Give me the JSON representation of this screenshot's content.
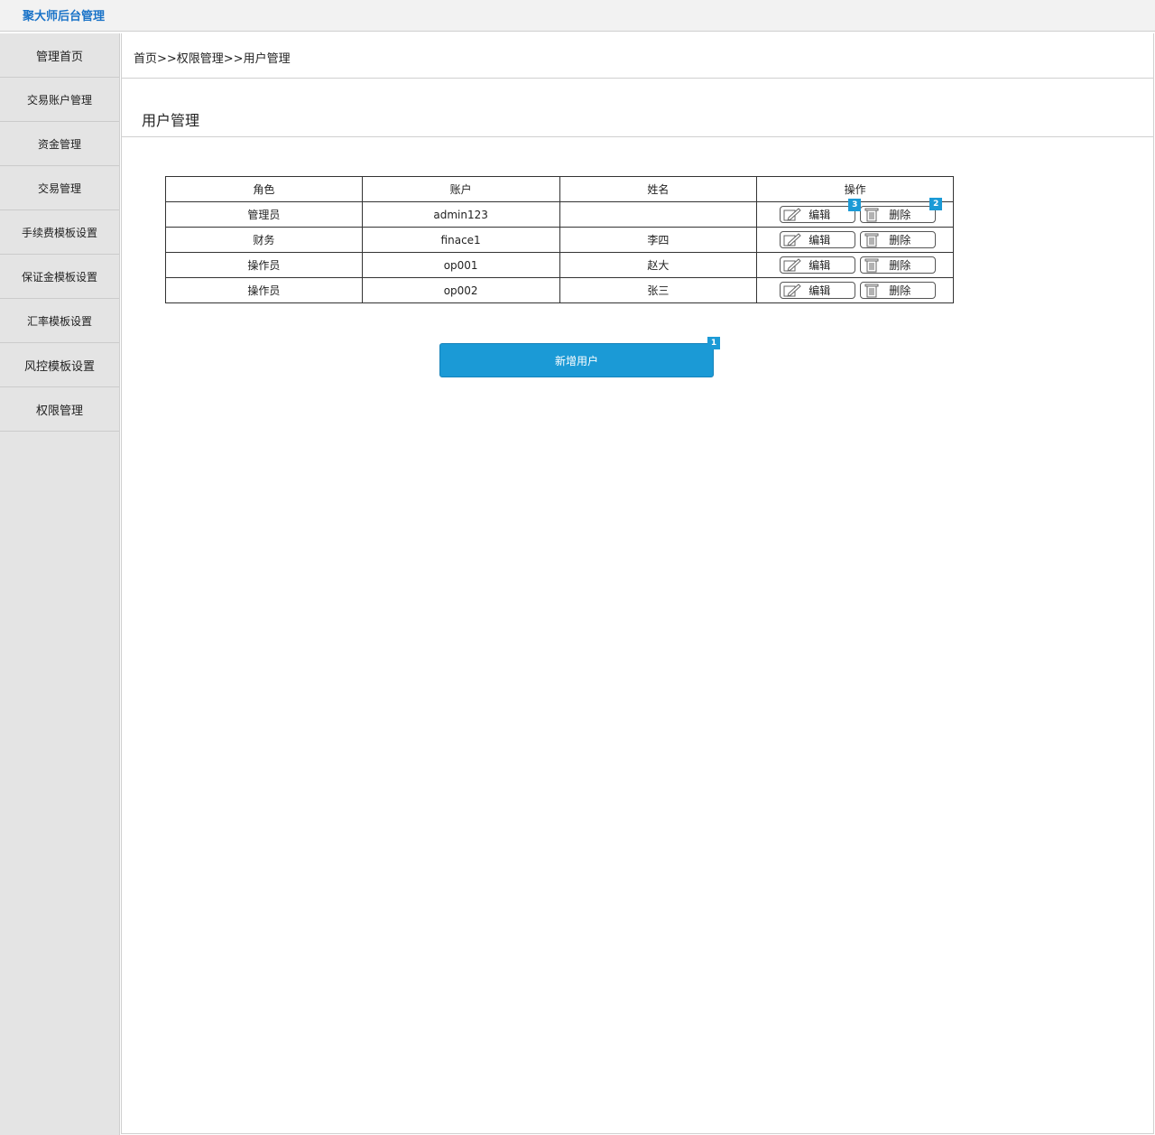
{
  "app": {
    "title": "聚大师后台管理"
  },
  "sidebar": {
    "items": [
      {
        "label": "管理首页"
      },
      {
        "label": "交易账户管理"
      },
      {
        "label": "资金管理"
      },
      {
        "label": "交易管理"
      },
      {
        "label": "手续费模板设置"
      },
      {
        "label": "保证金模板设置"
      },
      {
        "label": "汇率模板设置"
      },
      {
        "label": "风控模板设置"
      },
      {
        "label": "权限管理"
      }
    ]
  },
  "main": {
    "breadcrumb": "首页>>权限管理>>用户管理",
    "title": "用户管理",
    "table": {
      "headers": [
        "角色",
        "账户",
        "姓名",
        "操作"
      ],
      "edit_label": "编辑",
      "delete_label": "删除",
      "rows": [
        {
          "role": "管理员",
          "account": "admin123",
          "name": ""
        },
        {
          "role": "财务",
          "account": "finace1",
          "name": "李四"
        },
        {
          "role": "操作员",
          "account": "op001",
          "name": "赵大"
        },
        {
          "role": "操作员",
          "account": "op002",
          "name": "张三"
        }
      ]
    },
    "add_button": "新增用户",
    "markers": {
      "add": "1",
      "delete": "2",
      "edit": "3"
    }
  },
  "colors": {
    "accent": "#1b9ad6",
    "title": "#1a73c8",
    "sidebar_bg": "#e4e4e4"
  },
  "icons": {
    "edit": "pencil-edit-icon",
    "delete": "trash-icon"
  }
}
